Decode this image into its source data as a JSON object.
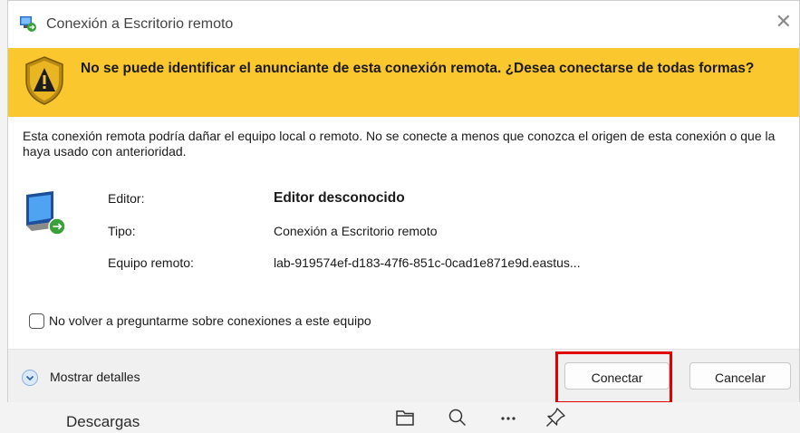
{
  "dialog": {
    "title": "Conexión a Escritorio remoto",
    "close_glyph": "✕",
    "warning": "No se puede identificar el anunciante de esta conexión remota. ¿Desea conectarse de todas formas?",
    "description": "Esta conexión remota podría dañar el equipo local o remoto. No se conecte a menos que conozca el origen de esta conexión o que la haya usado con anterioridad.",
    "details": [
      {
        "label": "Editor:",
        "value": "Editor desconocido"
      },
      {
        "label": "Tipo:",
        "value": "Conexión a Escritorio remoto"
      },
      {
        "label": "Equipo remoto:",
        "value": "lab-919574ef-d183-47f6-851c-0cad1e871e9d.eastus..."
      }
    ],
    "checkbox_label": "No volver a preguntarme sobre conexiones a este equipo",
    "checkbox_checked": false,
    "show_details_label": "Mostrar detalles",
    "connect_label": "Conectar",
    "cancel_label": "Cancelar"
  },
  "background": {
    "downloads_label": "Descargas",
    "toolbar_icons": [
      "folder-icon",
      "search-icon",
      "more-icon",
      "pin-icon"
    ]
  },
  "colors": {
    "warning_band": "#fbc72f",
    "highlight": "#e00000"
  }
}
